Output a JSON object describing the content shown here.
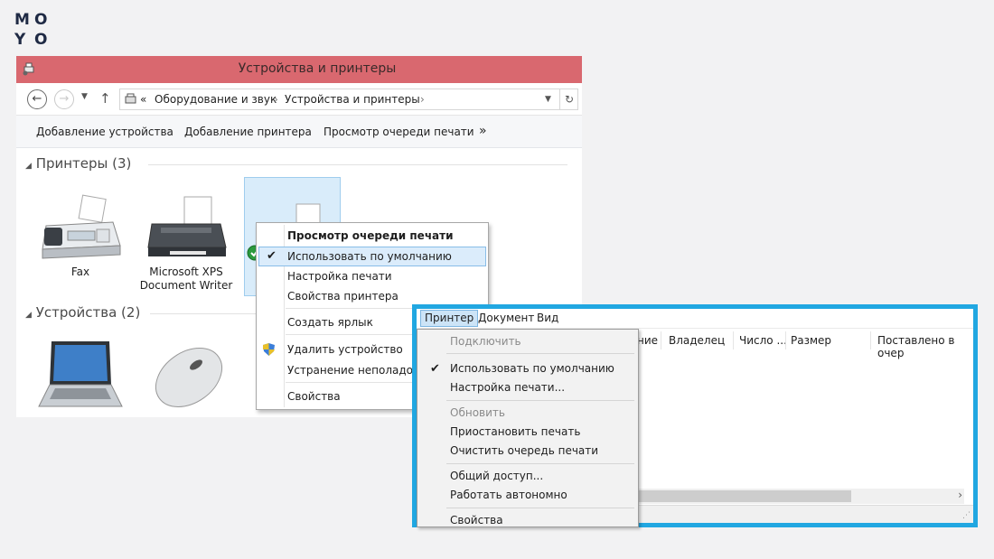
{
  "logo": {
    "l1": "M",
    "l2": "O",
    "l3": "Y",
    "l4": "O"
  },
  "devices_window": {
    "title": "Устройства и принтеры",
    "address": {
      "chevrons": "«",
      "crumb1": "Оборудование и звук",
      "arrow1": "›",
      "crumb2": "Устройства и принтеры",
      "arrow2": "›"
    },
    "commands": [
      "Добавление устройства",
      "Добавление принтера",
      "Просмотр очереди печати",
      "»"
    ],
    "printers_group": "Принтеры (3)",
    "devices_group": "Устройства (2)",
    "printers": [
      {
        "label": "Fax",
        "icon": "fax-icon"
      },
      {
        "label": "Microsoft XPS Document Writer",
        "label_line1": "Microsoft XPS",
        "label_line2": "Document Writer",
        "icon": "printer-icon"
      },
      {
        "label": "",
        "icon": "printer-icon"
      }
    ],
    "devices": [
      {
        "label": "",
        "icon": "laptop-icon"
      },
      {
        "label": "",
        "icon": "mouse-icon"
      }
    ]
  },
  "context_menu": {
    "items": [
      {
        "label": "Просмотр очереди печати",
        "bold": true
      },
      {
        "label": "Использовать по умолчанию",
        "checked": true,
        "highlighted": true
      },
      {
        "label": "Настройка печати"
      },
      {
        "label": "Свойства принтера"
      },
      {
        "label": "Создать ярлык"
      },
      {
        "label": "Удалить устройство",
        "icon": "uac-shield-icon"
      },
      {
        "label": "Устранение неполадок"
      },
      {
        "label": "Свойства"
      }
    ],
    "check_glyph": "✔"
  },
  "queue_window": {
    "menus": [
      "Принтер",
      "Документ",
      "Вид"
    ],
    "columns": [
      "ние",
      "Владелец",
      "Число ...",
      "Размер",
      "Поставлено в очер"
    ],
    "menu_items": [
      {
        "label": "Подключить",
        "disabled": true
      },
      {
        "label": "Использовать по умолчанию",
        "checked": true
      },
      {
        "label": "Настройка печати..."
      },
      {
        "label": "Обновить",
        "disabled": true
      },
      {
        "label": "Приостановить печать"
      },
      {
        "label": "Очистить очередь печати"
      },
      {
        "label": "Общий доступ..."
      },
      {
        "label": "Работать автономно"
      },
      {
        "label": "Свойства"
      }
    ],
    "scroll_arrow": "›"
  },
  "colors": {
    "titlebar": "#d9686f",
    "frame": "#21a7e1",
    "selection": "#d9ecfa"
  }
}
